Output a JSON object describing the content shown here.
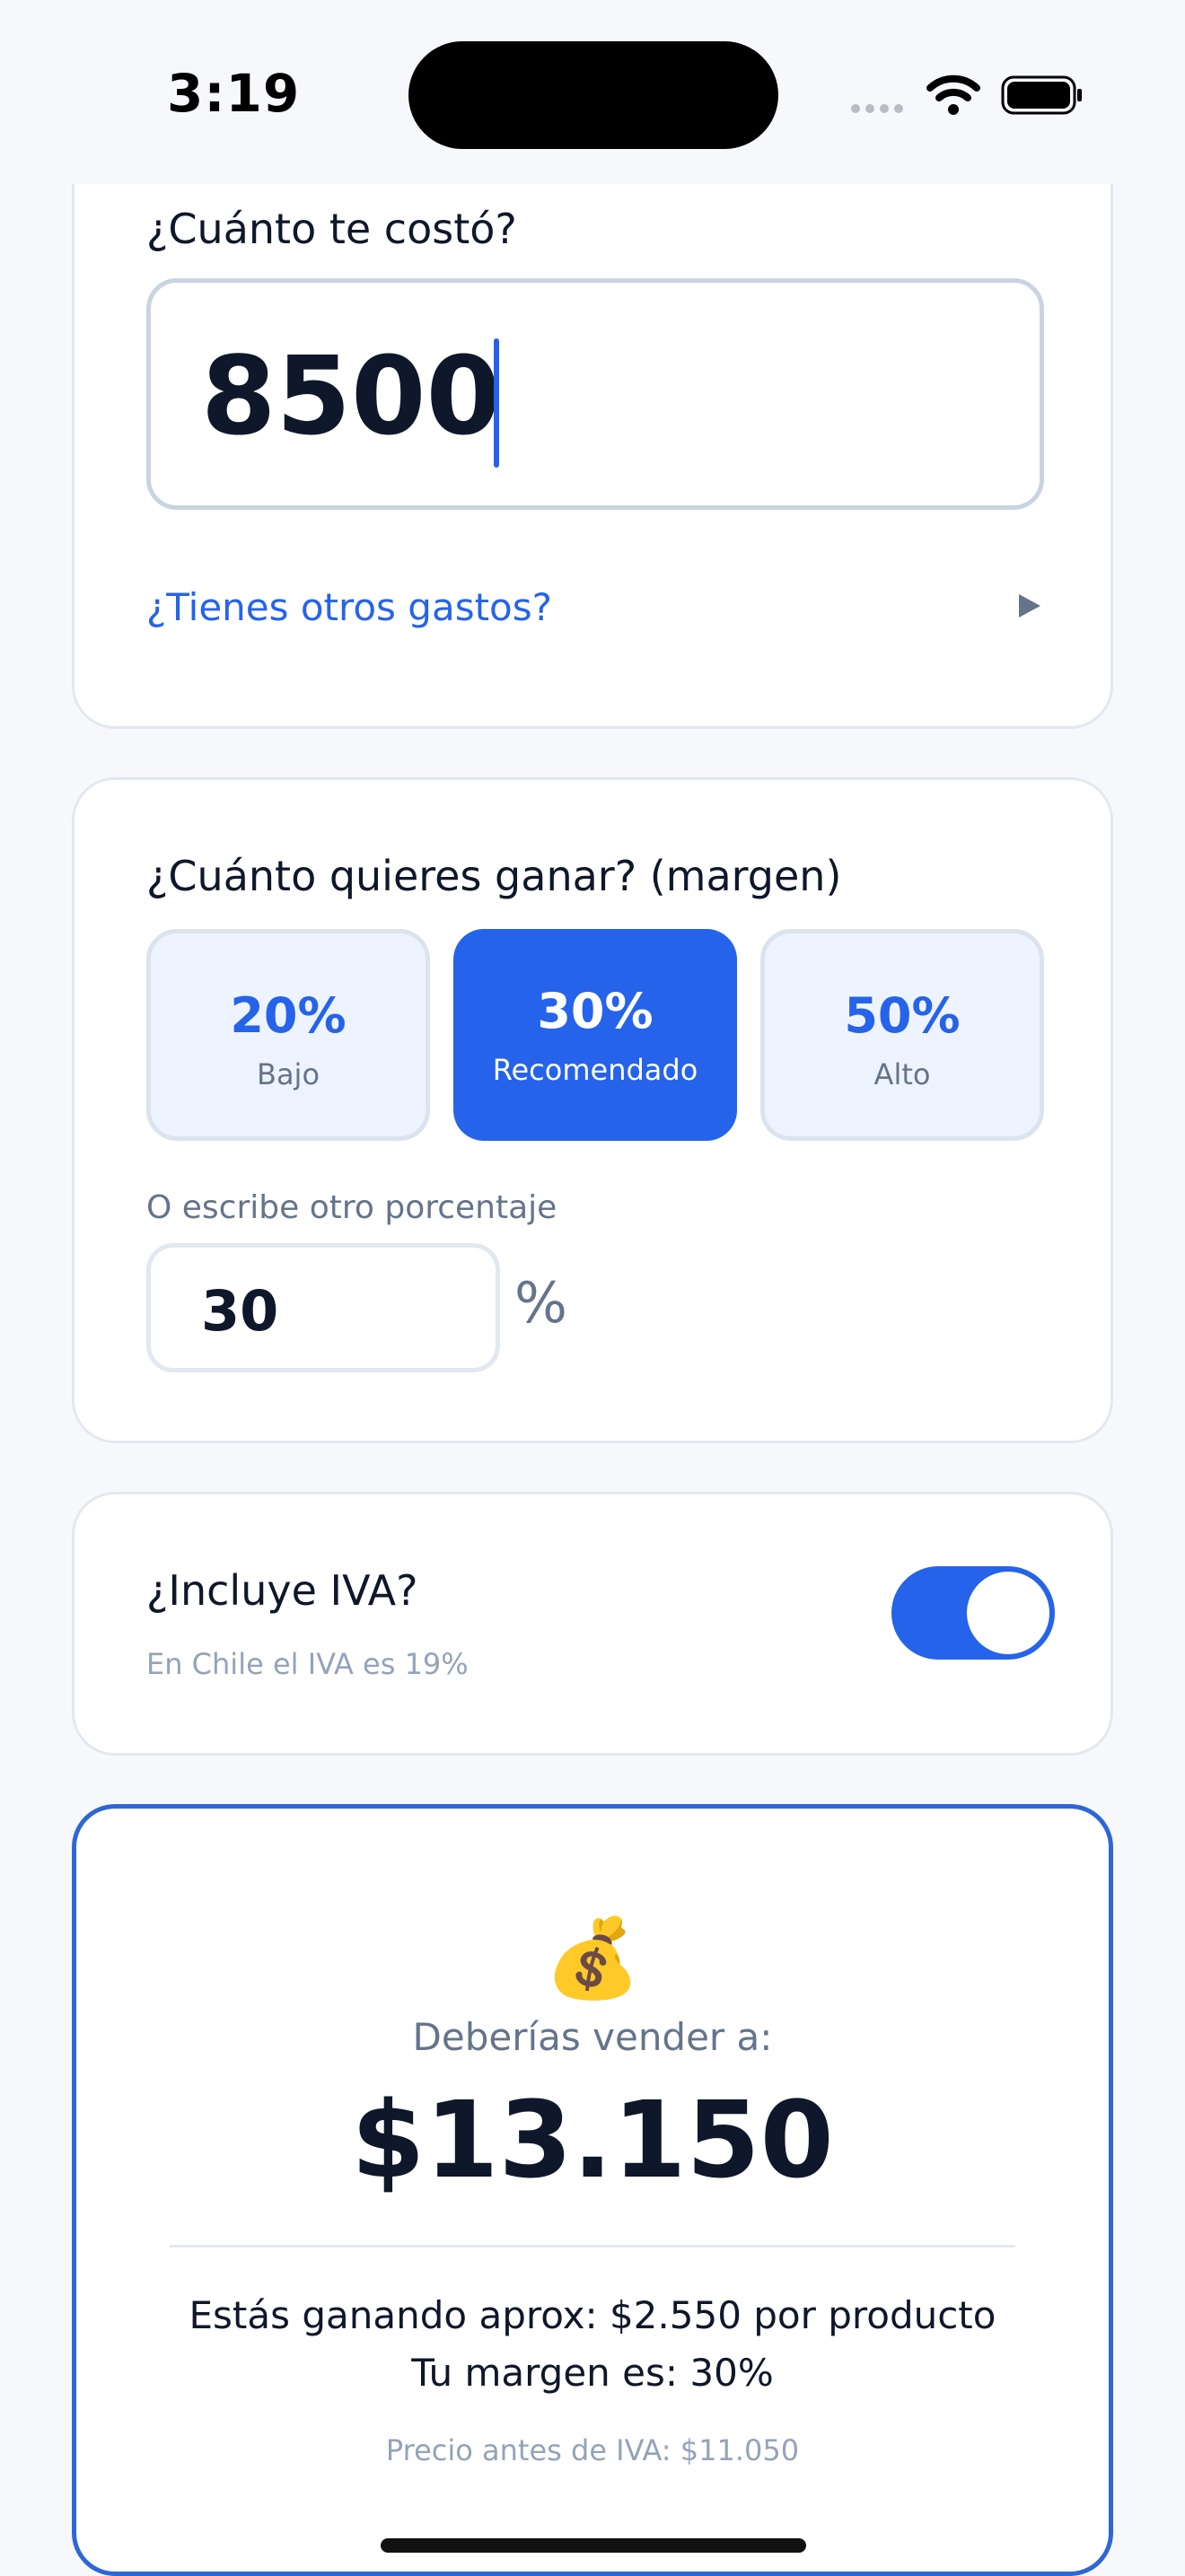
{
  "status_bar": {
    "time": "3:19"
  },
  "cost_section": {
    "label": "¿Cuánto te costó?",
    "value": "8500",
    "extras_link": "¿Tienes otros gastos?"
  },
  "margin_section": {
    "label": "¿Cuánto quieres ganar? (margen)",
    "options": [
      {
        "pct": "20%",
        "label": "Bajo"
      },
      {
        "pct": "30%",
        "label": "Recomendado"
      },
      {
        "pct": "50%",
        "label": "Alto"
      }
    ],
    "selected": "30%",
    "custom_label": "O escribe otro porcentaje",
    "custom_value": "30",
    "percent_sign": "%"
  },
  "iva_section": {
    "label": "¿Incluye IVA?",
    "subtext": "En Chile el IVA es 19%",
    "enabled": true
  },
  "result": {
    "icon": "💰",
    "label": "Deberías vender a:",
    "price": "$13.150",
    "gain": "Estás ganando aprox: $2.550 por producto",
    "margin": "Tu margen es: 30%",
    "pre_iva": "Precio antes de IVA: $11.050"
  },
  "colors": {
    "accent": "#2563eb",
    "background": "#f6f8fb"
  }
}
